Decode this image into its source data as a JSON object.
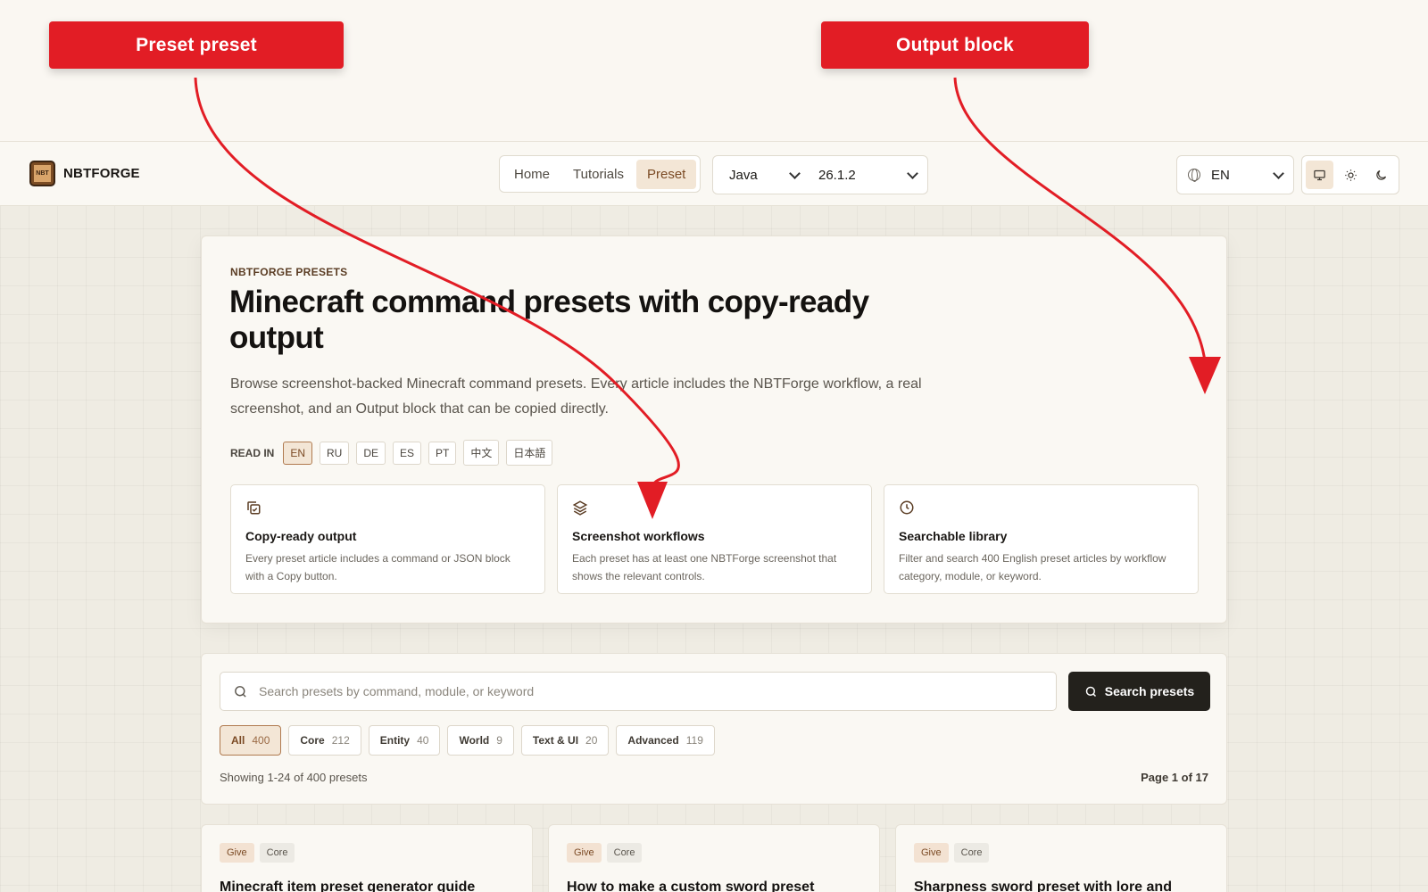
{
  "annotations": {
    "callout_left": "Preset preset",
    "callout_right": "Output block"
  },
  "brand": {
    "logo_text": "NBT",
    "name": "NBTFORGE"
  },
  "nav": {
    "links": [
      {
        "label": "Home"
      },
      {
        "label": "Tutorials"
      },
      {
        "label": "Preset",
        "active": true
      }
    ],
    "edition": "Java",
    "version": "26.1.2",
    "language": "EN",
    "theme_buttons": [
      "monitor-icon",
      "sun-icon",
      "moon-icon"
    ]
  },
  "hero": {
    "eyebrow": "NBTFORGE PRESETS",
    "title": "Minecraft command presets with copy-ready output",
    "description": "Browse screenshot-backed Minecraft command presets. Every article includes the NBTForge workflow, a real screenshot, and an Output block that can be copied directly.",
    "read_in_label": "READ IN",
    "languages": [
      "EN",
      "RU",
      "DE",
      "ES",
      "PT",
      "中文",
      "日本語"
    ],
    "features": [
      {
        "icon": "copy-check-icon",
        "title": "Copy-ready output",
        "desc": "Every preset article includes a command or JSON block with a Copy button."
      },
      {
        "icon": "layers-icon",
        "title": "Screenshot workflows",
        "desc": "Each preset has at least one NBTForge screenshot that shows the relevant controls."
      },
      {
        "icon": "clock-icon",
        "title": "Searchable library",
        "desc": "Filter and search 400 English preset articles by workflow category, module, or keyword."
      }
    ]
  },
  "search": {
    "placeholder": "Search presets by command, module, or keyword",
    "button": "Search presets",
    "filters": [
      {
        "label": "All",
        "count": "400",
        "active": true
      },
      {
        "label": "Core",
        "count": "212"
      },
      {
        "label": "Entity",
        "count": "40"
      },
      {
        "label": "World",
        "count": "9"
      },
      {
        "label": "Text & UI",
        "count": "20"
      },
      {
        "label": "Advanced",
        "count": "119"
      }
    ],
    "showing": "Showing 1-24 of 400 presets",
    "page": "Page 1 of 17"
  },
  "results": [
    {
      "tags": [
        "Give",
        "Core"
      ],
      "title": "Minecraft item preset generator guide"
    },
    {
      "tags": [
        "Give",
        "Core"
      ],
      "title": "How to make a custom sword preset"
    },
    {
      "tags": [
        "Give",
        "Core"
      ],
      "title": "Sharpness sword preset with lore and"
    }
  ],
  "colors": {
    "accent": "#7b4a24",
    "accent_bg": "#f3e6d6",
    "callout_red": "#e21d25",
    "dark_button": "#23211c"
  }
}
